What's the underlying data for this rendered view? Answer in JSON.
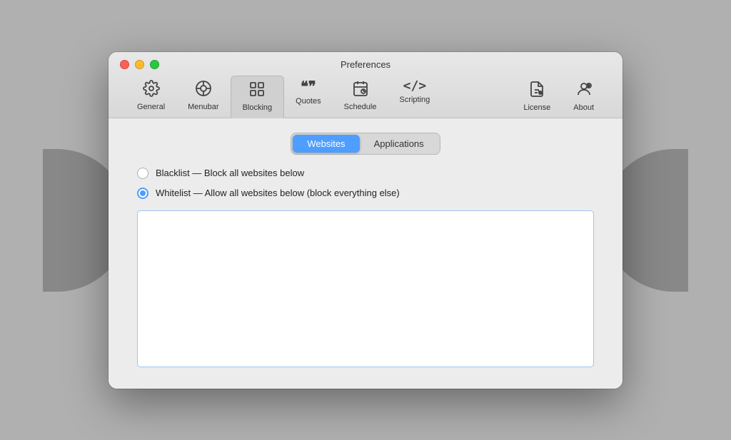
{
  "window": {
    "title": "Preferences"
  },
  "toolbar": {
    "left_items": [
      {
        "id": "general",
        "label": "General",
        "icon": "⚙"
      },
      {
        "id": "menubar",
        "label": "Menubar",
        "icon": "◎"
      },
      {
        "id": "blocking",
        "label": "Blocking",
        "icon": "▦",
        "active": true
      },
      {
        "id": "quotes",
        "label": "Quotes",
        "icon": "❝"
      },
      {
        "id": "schedule",
        "label": "Schedule",
        "icon": "📅"
      },
      {
        "id": "scripting",
        "label": "Scripting",
        "icon": "</>"
      }
    ],
    "right_items": [
      {
        "id": "license",
        "label": "License",
        "icon": "📄"
      },
      {
        "id": "about",
        "label": "About",
        "icon": "👤"
      }
    ]
  },
  "segmented": {
    "tabs": [
      {
        "id": "websites",
        "label": "Websites",
        "active": true
      },
      {
        "id": "applications",
        "label": "Applications",
        "active": false
      }
    ]
  },
  "radio": {
    "options": [
      {
        "id": "blacklist",
        "label": "Blacklist — Block all websites below",
        "selected": false
      },
      {
        "id": "whitelist",
        "label": "Whitelist — Allow all websites below (block everything else)",
        "selected": true
      }
    ]
  },
  "list": {
    "placeholder": ""
  },
  "window_controls": {
    "close_label": "×",
    "min_label": "–",
    "max_label": "+"
  }
}
